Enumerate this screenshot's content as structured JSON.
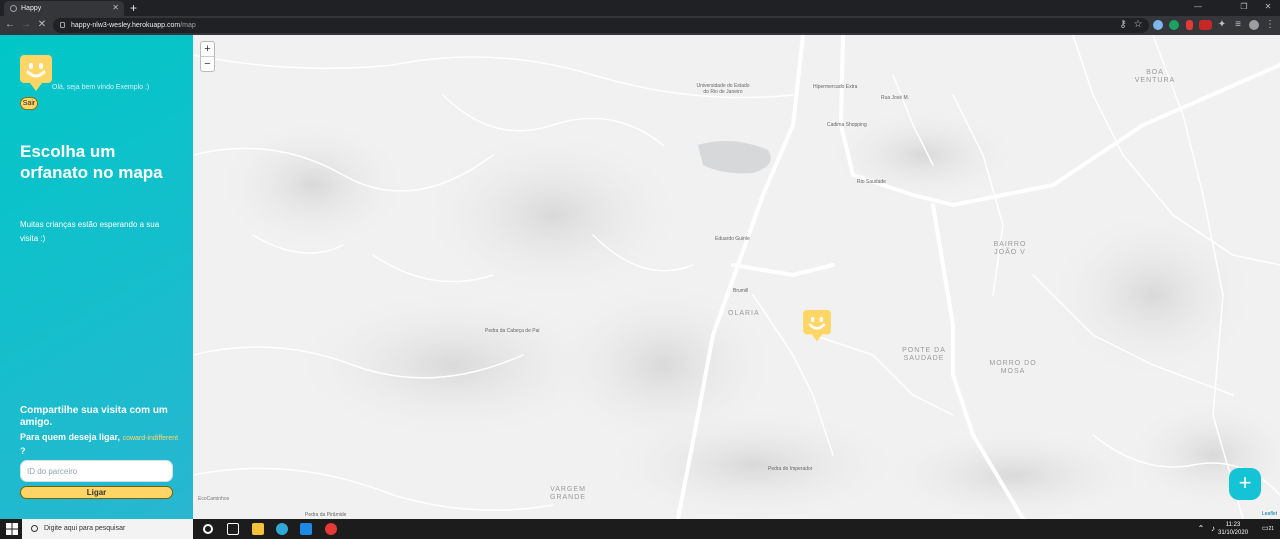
{
  "browser": {
    "tab_title": "Happy",
    "url_host": "happy-nlw3-wesley.herokuapp.com",
    "url_path": "/map"
  },
  "sidebar": {
    "welcome": "Olá, seja bem vindo Exemplo :)",
    "logout_label": "Sair",
    "title": "Escolha um orfanato no mapa",
    "subtitle": "Muitas crianças estão esperando a sua visita :)",
    "share_title": "Compartilhe sua visita com um amigo.",
    "share_question": "Para quem deseja ligar,",
    "share_link": "coward-indifferent",
    "share_question_mark": "?",
    "partner_placeholder": "ID do parceiro",
    "call_label": "Ligar"
  },
  "map": {
    "zoom_in": "+",
    "zoom_out": "−",
    "labels": {
      "uerj": "Universidade do Estado do Rio de Janeiro",
      "hipermercado": "Hipermercado Extra",
      "rua_jose": "Rua José M.",
      "shopping": "Cadima Shopping",
      "rio_saudade": "Rio Saudade",
      "eduardo": "Eduardo Guinle",
      "brumill": "Brumill",
      "pedra_cabeca": "Pedra da Cabeça de Pai",
      "pedra_imperador": "Pedra do Imperador",
      "pedra_piramide": "Pedra da Pirâmide",
      "ecocaminhos": "EcoCaminhos"
    },
    "areas": {
      "boa_ventura": "BOA VENTURA",
      "bairro_joao": "BAIRRO JOÃO V",
      "olaria": "OLARIA",
      "ponte_saudade": "PONTE DA SAUDADE",
      "morro_mosa": "MORRO DO MOSA",
      "vargem_grande": "VARGEM GRANDE"
    },
    "attribution": "Leaflet",
    "fab_label": "+"
  },
  "taskbar": {
    "search_placeholder": "Digite aqui para pesquisar",
    "time": "11:23",
    "date": "31/10/2020",
    "notif_count": "21"
  }
}
